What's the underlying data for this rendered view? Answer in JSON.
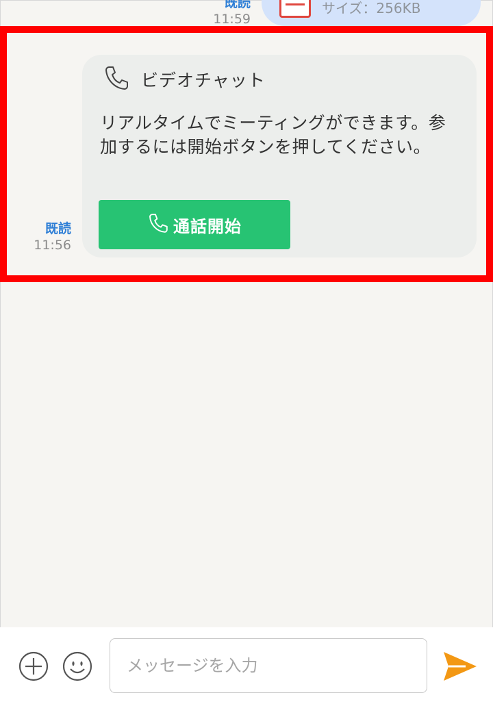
{
  "previous_message": {
    "read_label": "既読",
    "time": "11:59",
    "file_size": "サイズ：256KB"
  },
  "message": {
    "read_label": "既読",
    "time": "11:56",
    "title": "ビデオチャット",
    "body": "リアルタイムでミーティングができます。参加するには開始ボタンを押してください。",
    "button_label": "通話開始"
  },
  "composer": {
    "placeholder": "メッセージを入力",
    "value": ""
  },
  "icons": {
    "call": "phone-icon",
    "add": "plus-circle-icon",
    "emoji": "smiley-icon",
    "send": "paper-plane-icon",
    "file": "file-icon"
  },
  "colors": {
    "read_label": "#2f7fd6",
    "call_button": "#27c373",
    "send": "#f39814",
    "highlight": "#ff0000",
    "bubble": "#eceeec",
    "previous_bubble": "#d4e3fb"
  }
}
